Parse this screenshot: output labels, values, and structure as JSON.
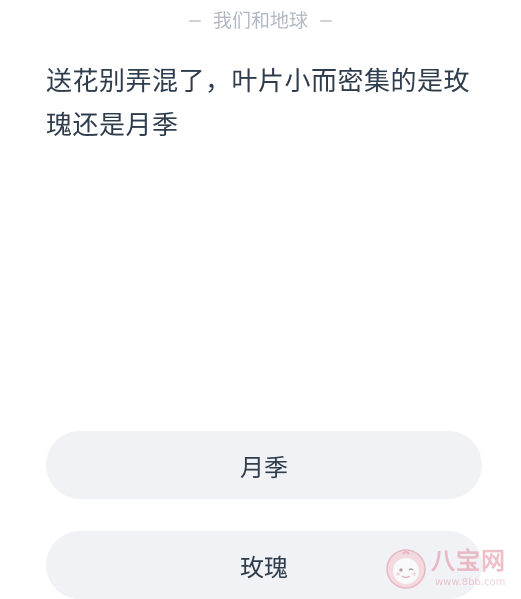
{
  "header": {
    "category": "我们和地球"
  },
  "question": {
    "text": "送花别弄混了，叶片小而密集的是玫瑰还是月季"
  },
  "options": [
    {
      "label": "月季"
    },
    {
      "label": "玫瑰"
    }
  ],
  "watermark": {
    "title": "八宝网",
    "url": "www.8bb.com",
    "color": "#e38c9c"
  }
}
